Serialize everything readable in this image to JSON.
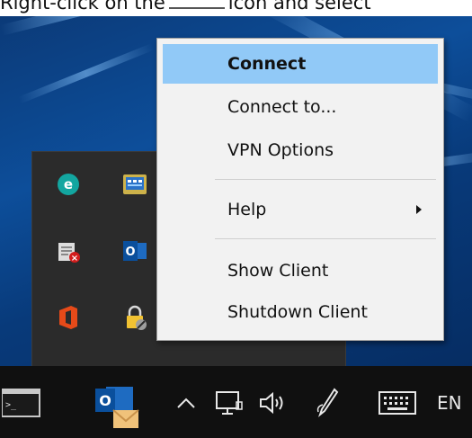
{
  "caption": {
    "prefix": "Right-click on the",
    "suffix": "icon and select"
  },
  "menu": {
    "items": [
      {
        "label": "Connect",
        "highlighted": true,
        "bold": true
      },
      {
        "label": "Connect to..."
      },
      {
        "label": "VPN Options"
      },
      {
        "label": "Help",
        "has_submenu": true
      },
      {
        "label": "Show Client"
      },
      {
        "label": "Shutdown Client"
      }
    ]
  },
  "tray_icons": [
    "eset-icon",
    "network-adapter-icon",
    "security-warning-icon",
    "outlook-icon",
    "office-icon",
    "vpn-lock-icon"
  ],
  "taskbar": {
    "language": "EN",
    "icons": [
      "terminal-icon",
      "outlook-icon",
      "chevron-up-icon",
      "network-icon",
      "volume-icon",
      "pen-icon",
      "keyboard-icon"
    ]
  },
  "colors": {
    "menu_highlight": "#91c9f7",
    "taskbar": "#101010",
    "flyout": "#2b2b2b"
  }
}
